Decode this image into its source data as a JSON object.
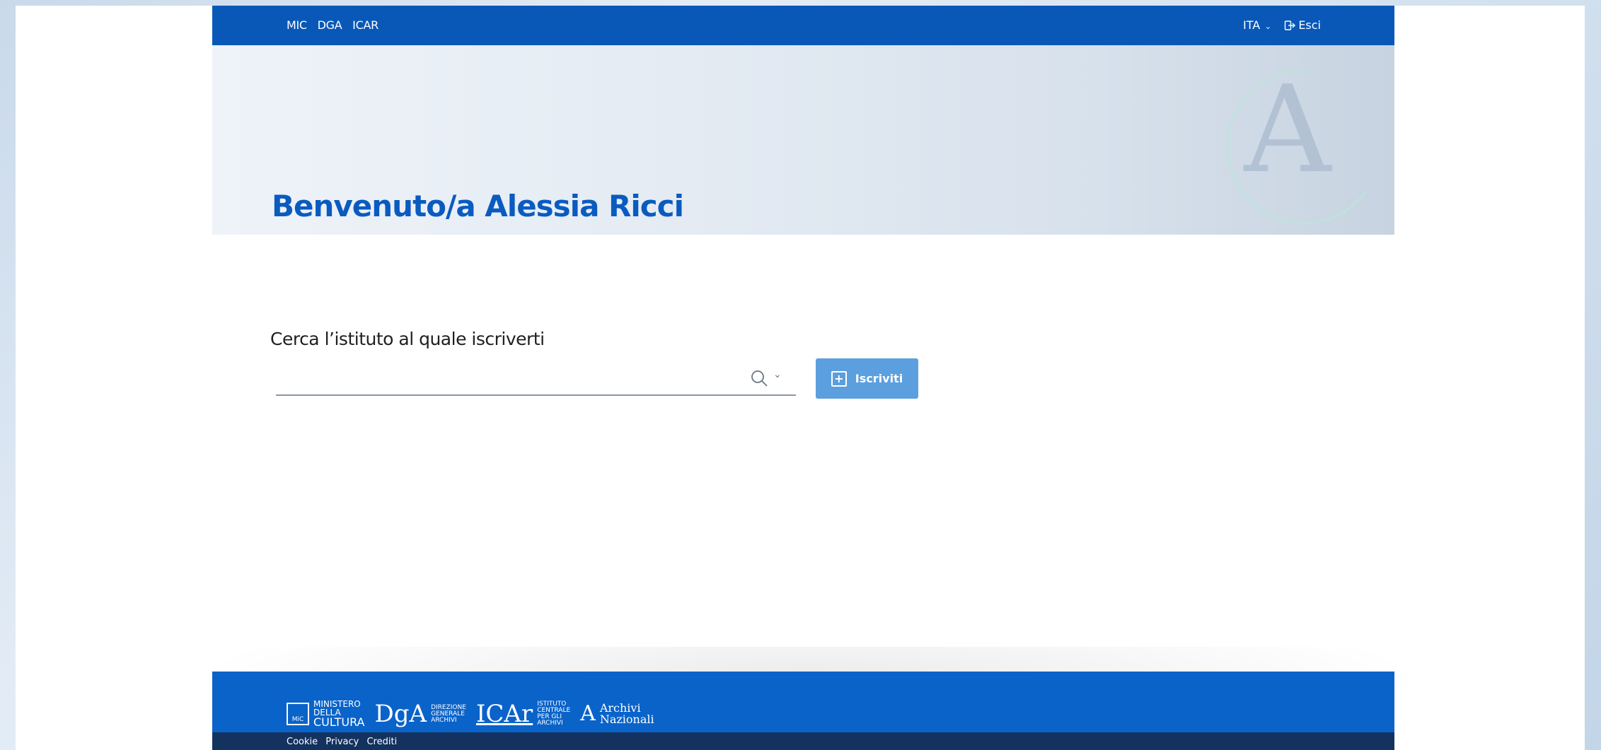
{
  "topbar": {
    "links": [
      "MIC",
      "DGA",
      "ICAR"
    ],
    "language": "ITA",
    "logout_label": "Esci"
  },
  "hero": {
    "welcome": "Benvenuto/a Alessia Ricci",
    "watermark_letter": "A"
  },
  "search": {
    "label": "Cerca l’istituto al quale iscriverti",
    "value": "",
    "placeholder": ""
  },
  "actions": {
    "subscribe_label": "Iscriviti"
  },
  "footer": {
    "logos": {
      "mic": [
        "MINISTERO",
        "DELLA",
        "CULTURA"
      ],
      "mic_badge": "MiC",
      "dga": "DgA",
      "dga_sub": [
        "DIREZIONE",
        "GENERALE",
        "ARCHIVI"
      ],
      "icar": "ICAr",
      "icar_sub": [
        "ISTITUTO",
        "CENTRALE",
        "PER GLI",
        "ARCHIVI"
      ],
      "an_letter": "A",
      "an": [
        "Archivi",
        "Nazionali"
      ]
    },
    "links": [
      "Cookie",
      "Privacy",
      "Crediti"
    ]
  },
  "colors": {
    "primary": "#0958b8",
    "heading": "#0a5bc0",
    "button": "#5c9fdf",
    "footer_bottom": "#13325f"
  },
  "icons": [
    "search-icon",
    "chevron-down-icon",
    "logout-icon",
    "plus-square-icon"
  ]
}
